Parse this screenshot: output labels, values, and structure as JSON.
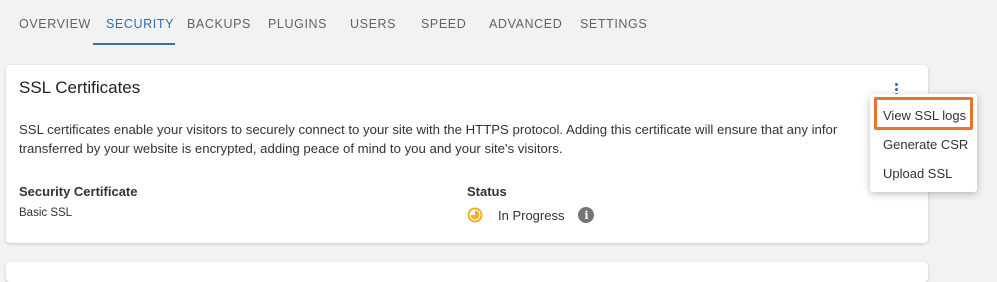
{
  "tabs": [
    {
      "label": "OVERVIEW"
    },
    {
      "label": "SECURITY"
    },
    {
      "label": "BACKUPS"
    },
    {
      "label": "PLUGINS"
    },
    {
      "label": "USERS"
    },
    {
      "label": "SPEED"
    },
    {
      "label": "ADVANCED"
    },
    {
      "label": "SETTINGS"
    }
  ],
  "active_tab": "SECURITY",
  "ssl_card": {
    "title": "SSL Certificates",
    "description_line1": "SSL certificates enable your visitors to securely connect to your site with the HTTPS protocol. Adding this certificate will ensure that any infor",
    "description_line2": "transferred by your website is encrypted, adding peace of mind to you and your site's visitors.",
    "certificate_label": "Security Certificate",
    "certificate_value": "Basic SSL",
    "status_label": "Status",
    "status_value": "In Progress",
    "status_icon": "in-progress-icon",
    "info_icon": "info-icon",
    "menu_icon": "kebab-menu-icon"
  },
  "menu": {
    "items": [
      {
        "label": "View SSL logs"
      },
      {
        "label": "Generate CSR"
      },
      {
        "label": "Upload SSL"
      }
    ],
    "highlighted": "View SSL logs"
  },
  "colors": {
    "accent": "#2f6fb0",
    "highlight_border": "#e8742d",
    "progress": "#f2b01e",
    "background": "#f2f2f2"
  }
}
